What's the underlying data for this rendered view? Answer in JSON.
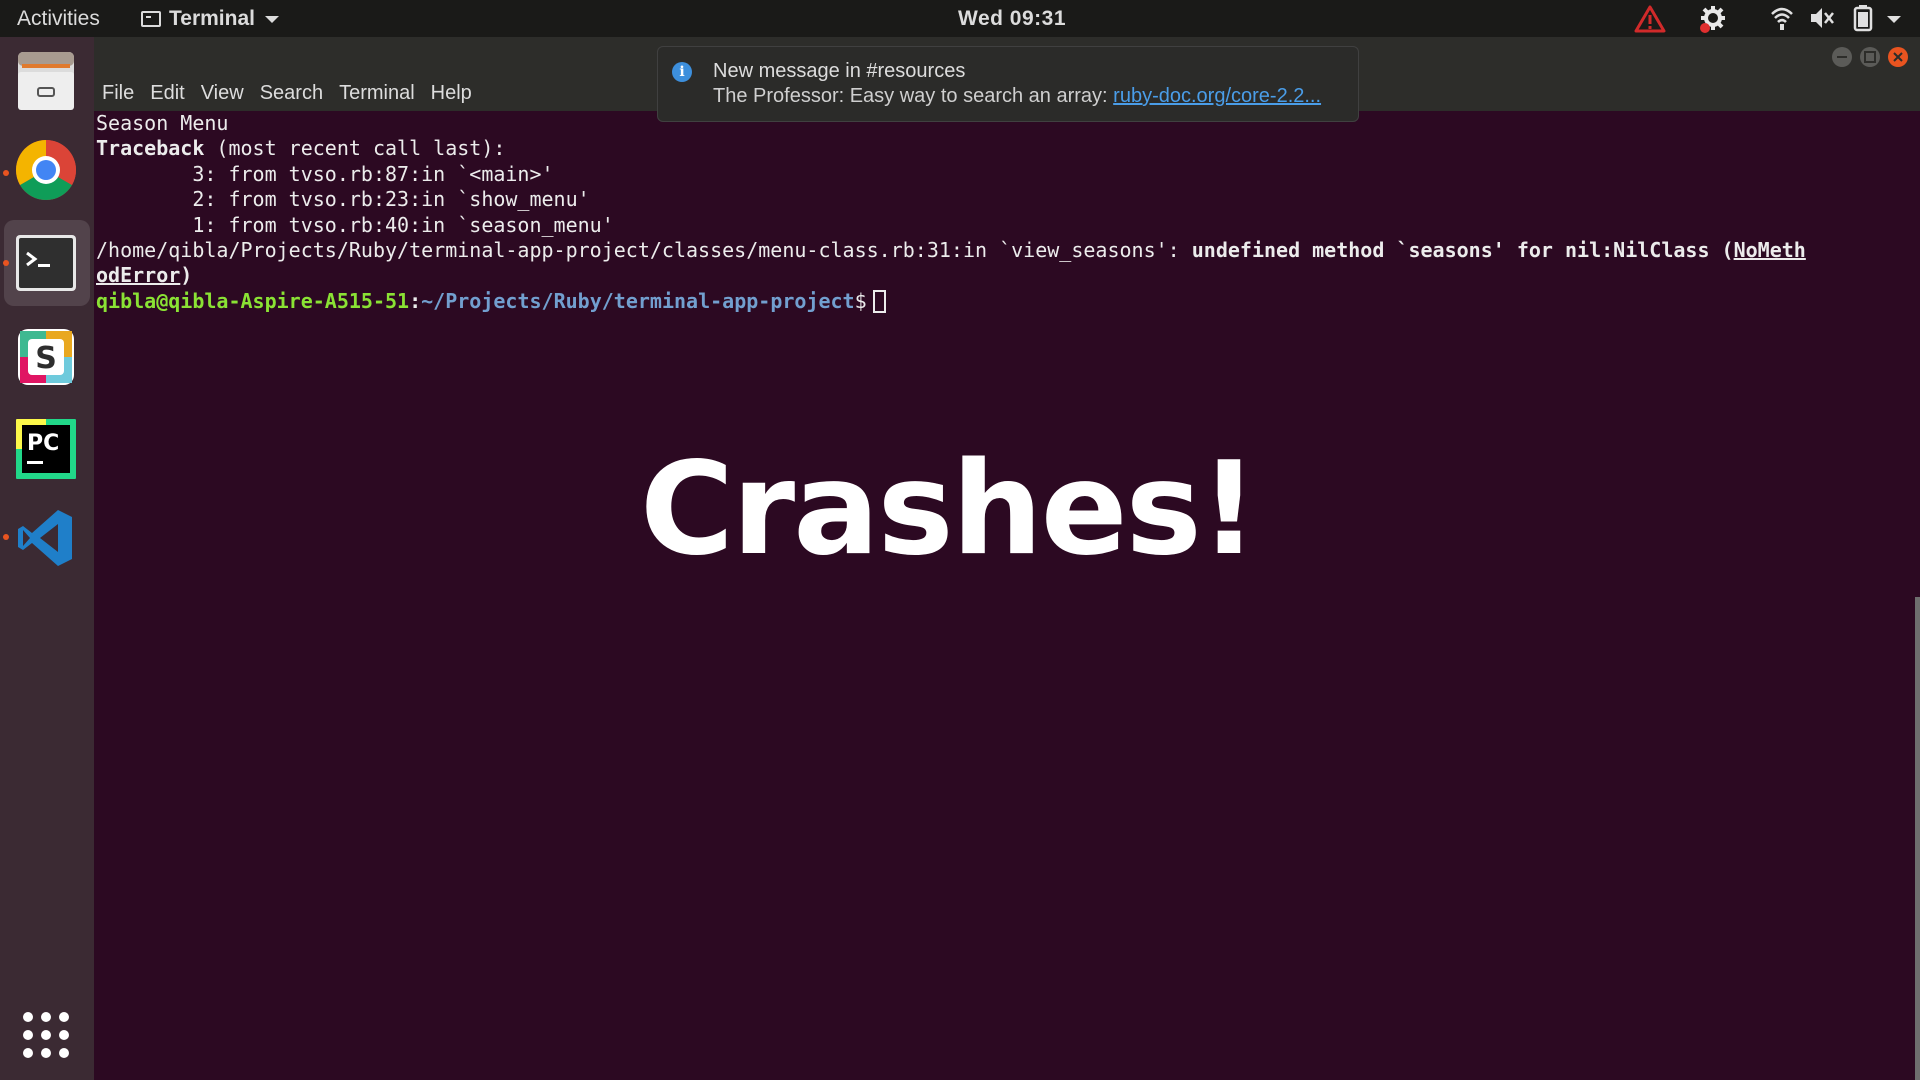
{
  "topbar": {
    "activities": "Activities",
    "app_menu": "Terminal",
    "clock": "Wed 09:31",
    "tray_icons": [
      "warning-icon",
      "settings-update-icon",
      "wifi-icon",
      "volume-icon",
      "battery-icon",
      "system-menu-caret-icon"
    ]
  },
  "dock": {
    "apps": [
      "files-icon",
      "chrome-icon",
      "terminal-icon",
      "slack-icon",
      "pycharm-icon",
      "vscode-icon"
    ],
    "show_apps": "show-applications-icon"
  },
  "window": {
    "menu": [
      "File",
      "Edit",
      "View",
      "Search",
      "Terminal",
      "Help"
    ]
  },
  "notification": {
    "title": "New message in #resources",
    "body_prefix": "The Professor: Easy way to search an array: ",
    "link": "ruby-doc.org/core-2.2..."
  },
  "terminal": {
    "line1": "Season Menu",
    "line2_bold": "Traceback",
    "line2_rest": " (most recent call last):",
    "line3": "        3: from tvso.rb:87:in `<main>'",
    "line4": "        2: from tvso.rb:23:in `show_menu'",
    "line5": "        1: from tvso.rb:40:in `season_menu'",
    "line6_plain": "/home/qibla/Projects/Ruby/terminal-app-project/classes/menu-class.rb:31:in `view_seasons': ",
    "line6_bold": "undefined method `seasons' for nil:NilClass (",
    "line6_err1": "NoMeth",
    "line7_err2": "odError",
    "line7_close": ")",
    "prompt_user": "qibla@qibla-Aspire-A515-51",
    "prompt_sep": ":",
    "prompt_path": "~/Projects/Ruby/terminal-app-project",
    "prompt_end": "$"
  },
  "overlay": {
    "caption": "Crashes!"
  },
  "colors": {
    "terminal_bg": "#2c0922",
    "accent": "#e95420",
    "prompt_user": "#8ae234",
    "prompt_path": "#729fcf"
  }
}
